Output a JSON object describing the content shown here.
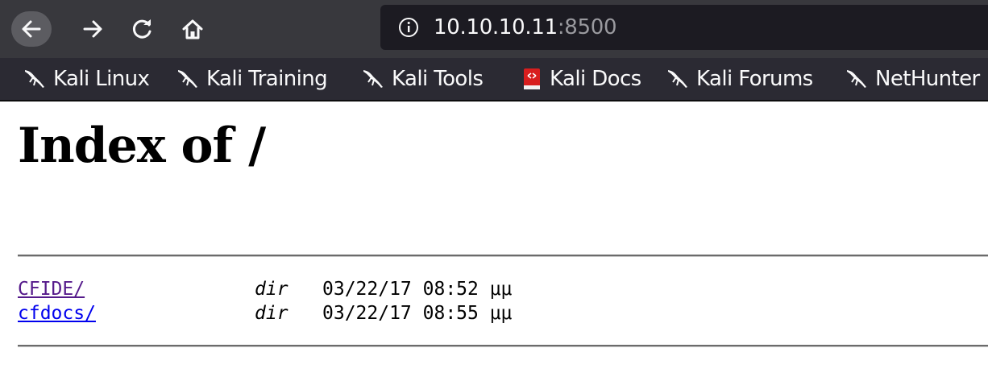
{
  "browser": {
    "address": {
      "host": "10.10.10.11",
      "port": ":8500"
    },
    "bookmarks": [
      {
        "label": "Kali Linux",
        "icon": "kali-dragon-icon"
      },
      {
        "label": "Kali Training",
        "icon": "kali-dragon-icon"
      },
      {
        "label": "Kali Tools",
        "icon": "kali-dragon-icon"
      },
      {
        "label": "Kali Docs",
        "icon": "kali-docs-icon"
      },
      {
        "label": "Kali Forums",
        "icon": "kali-dragon-icon"
      },
      {
        "label": "NetHunter",
        "icon": "kali-dragon-icon"
      }
    ]
  },
  "page": {
    "title": "Index of /",
    "entries": [
      {
        "name": "CFIDE/",
        "type": "dir",
        "date": "03/22/17 08:52 μμ",
        "visited": true
      },
      {
        "name": "cfdocs/",
        "type": "dir",
        "date": "03/22/17 08:55 μμ",
        "visited": false
      }
    ]
  },
  "colors": {
    "toolbar": "#38383d",
    "urlbar": "#1c1b22",
    "bookmarks_bar": "#2b2a33",
    "visited_link": "#551a8b",
    "link": "#0000ee"
  }
}
